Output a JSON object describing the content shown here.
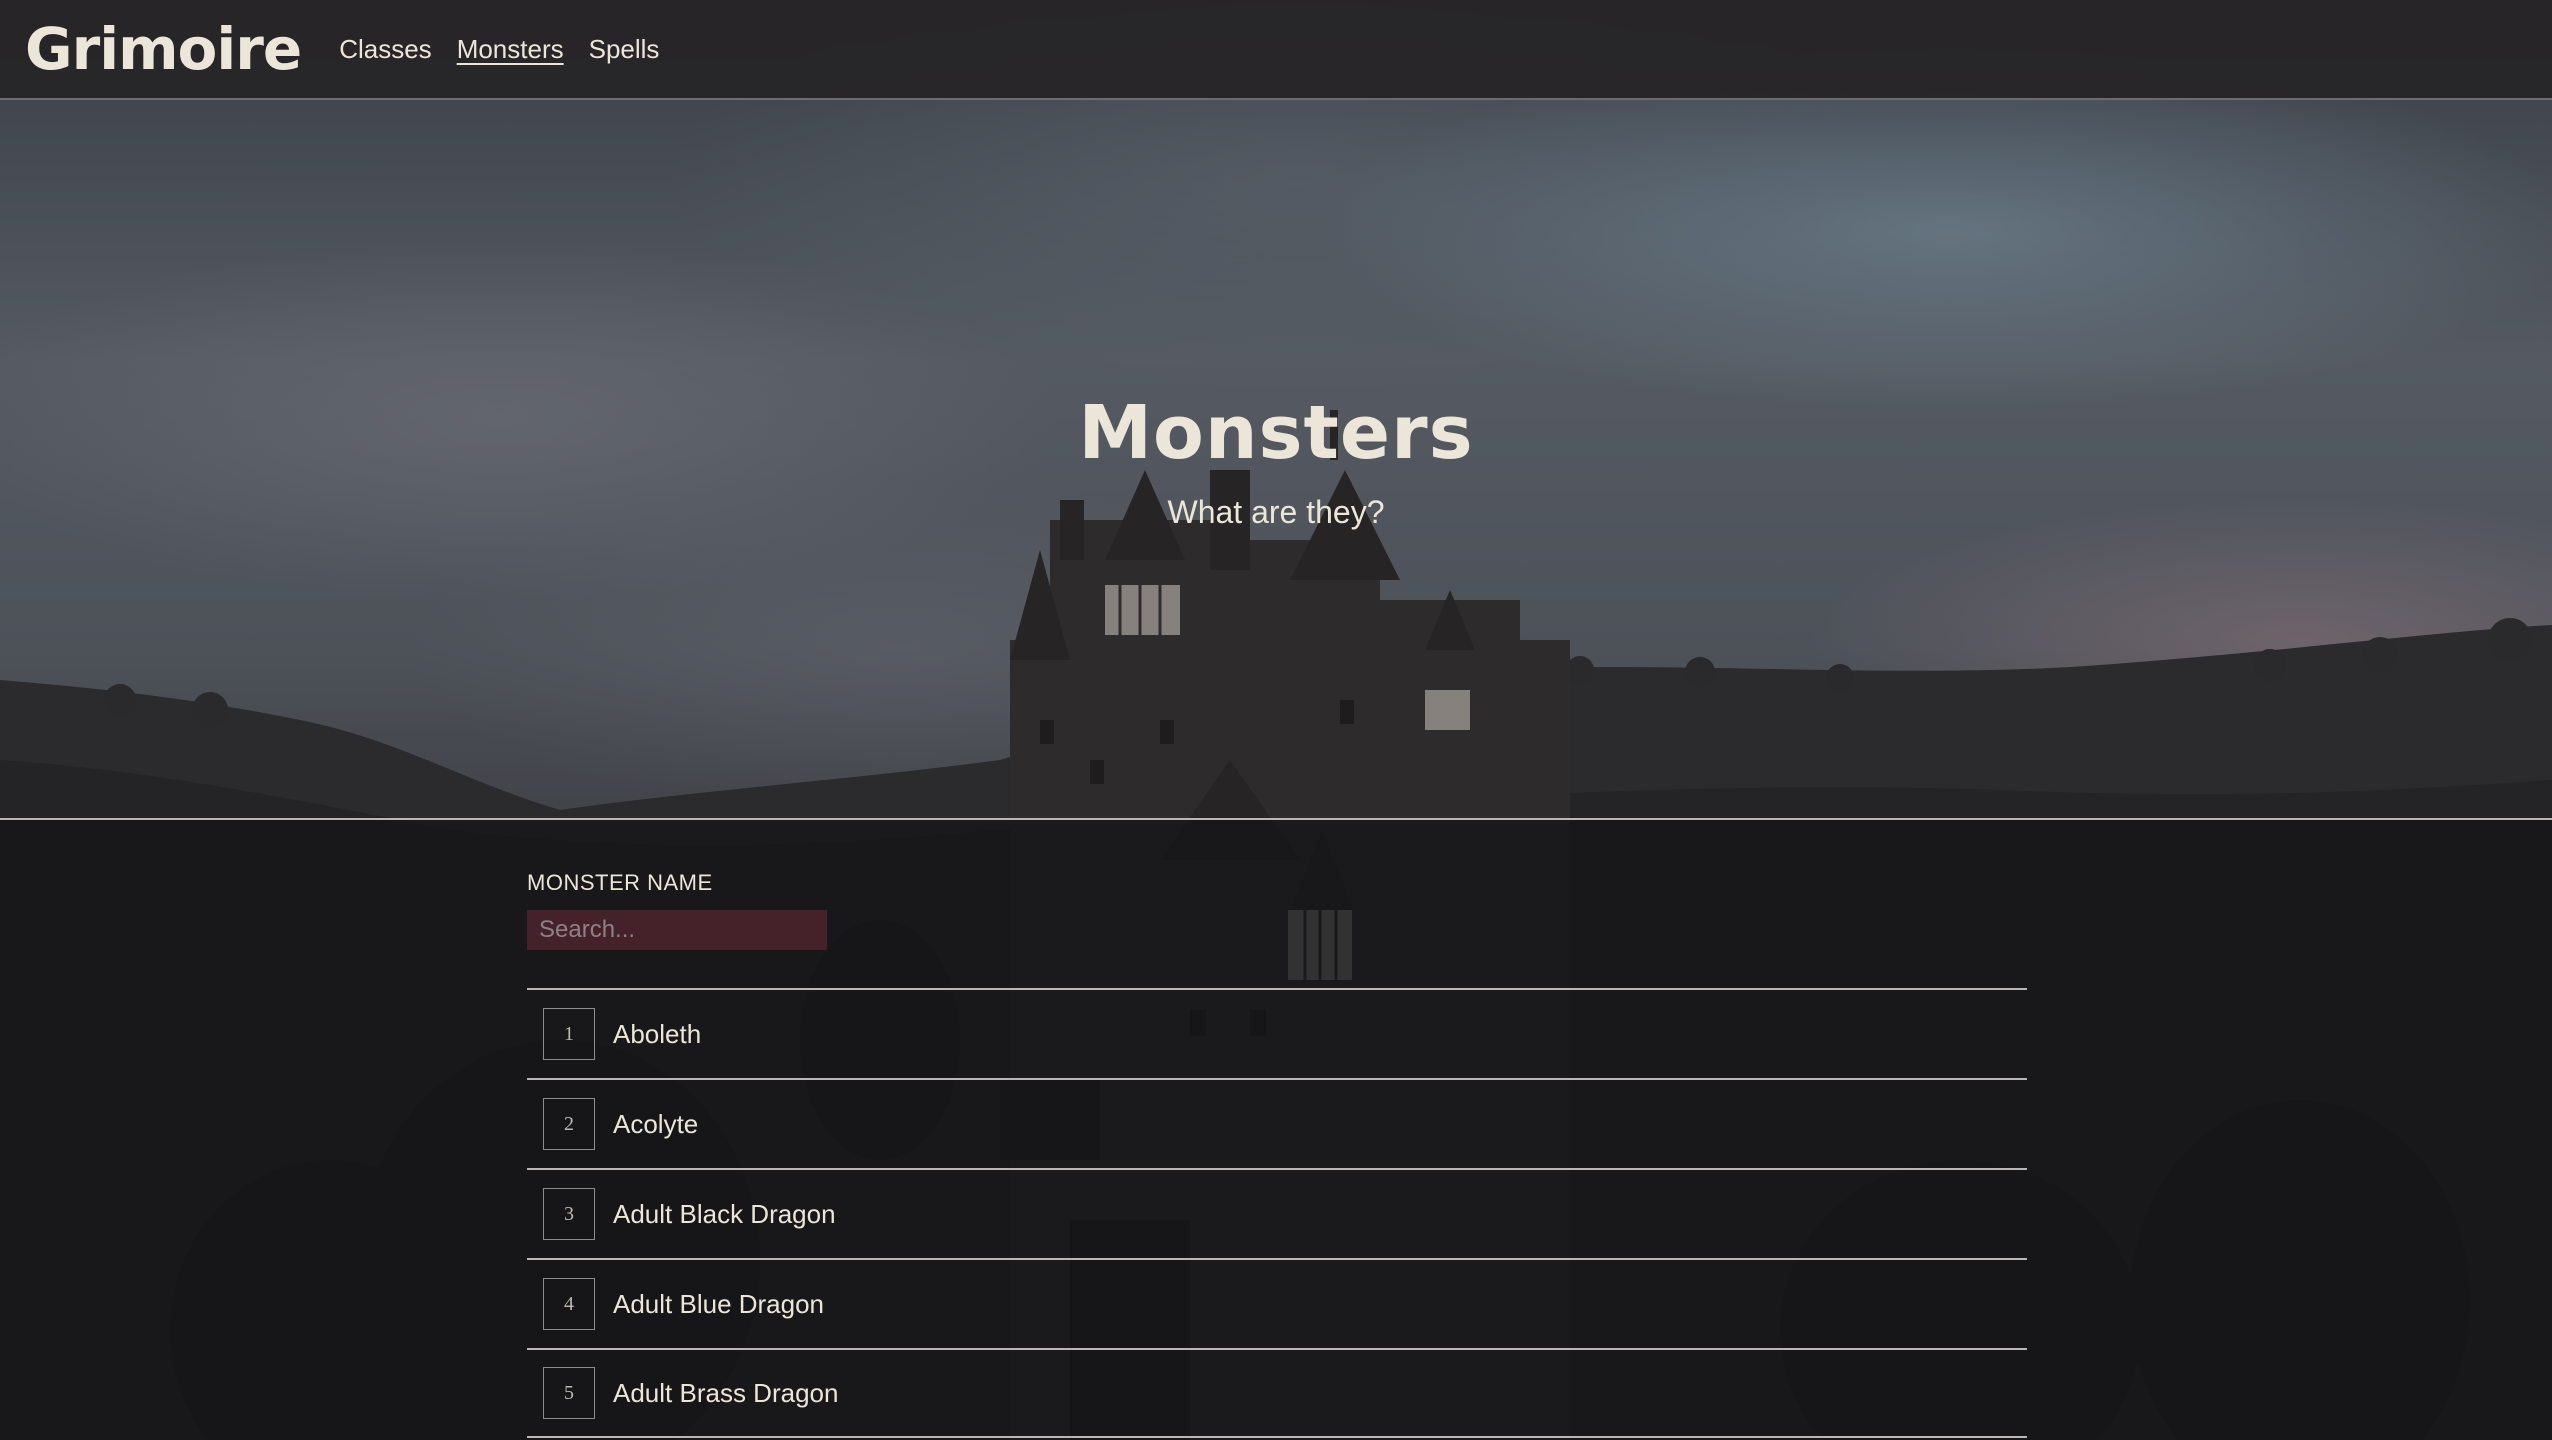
{
  "header": {
    "logo": "Grimoire",
    "nav": [
      {
        "label": "Classes",
        "active": false
      },
      {
        "label": "Monsters",
        "active": true
      },
      {
        "label": "Spells",
        "active": false
      }
    ]
  },
  "hero": {
    "title": "Monsters",
    "subtitle": "What are they?"
  },
  "filter": {
    "label": "MONSTER NAME",
    "placeholder": "Search..."
  },
  "monsters": [
    {
      "index": "1",
      "name": "Aboleth"
    },
    {
      "index": "2",
      "name": "Acolyte"
    },
    {
      "index": "3",
      "name": "Adult Black Dragon"
    },
    {
      "index": "4",
      "name": "Adult Blue Dragon"
    },
    {
      "index": "5",
      "name": "Adult Brass Dragon"
    }
  ]
}
